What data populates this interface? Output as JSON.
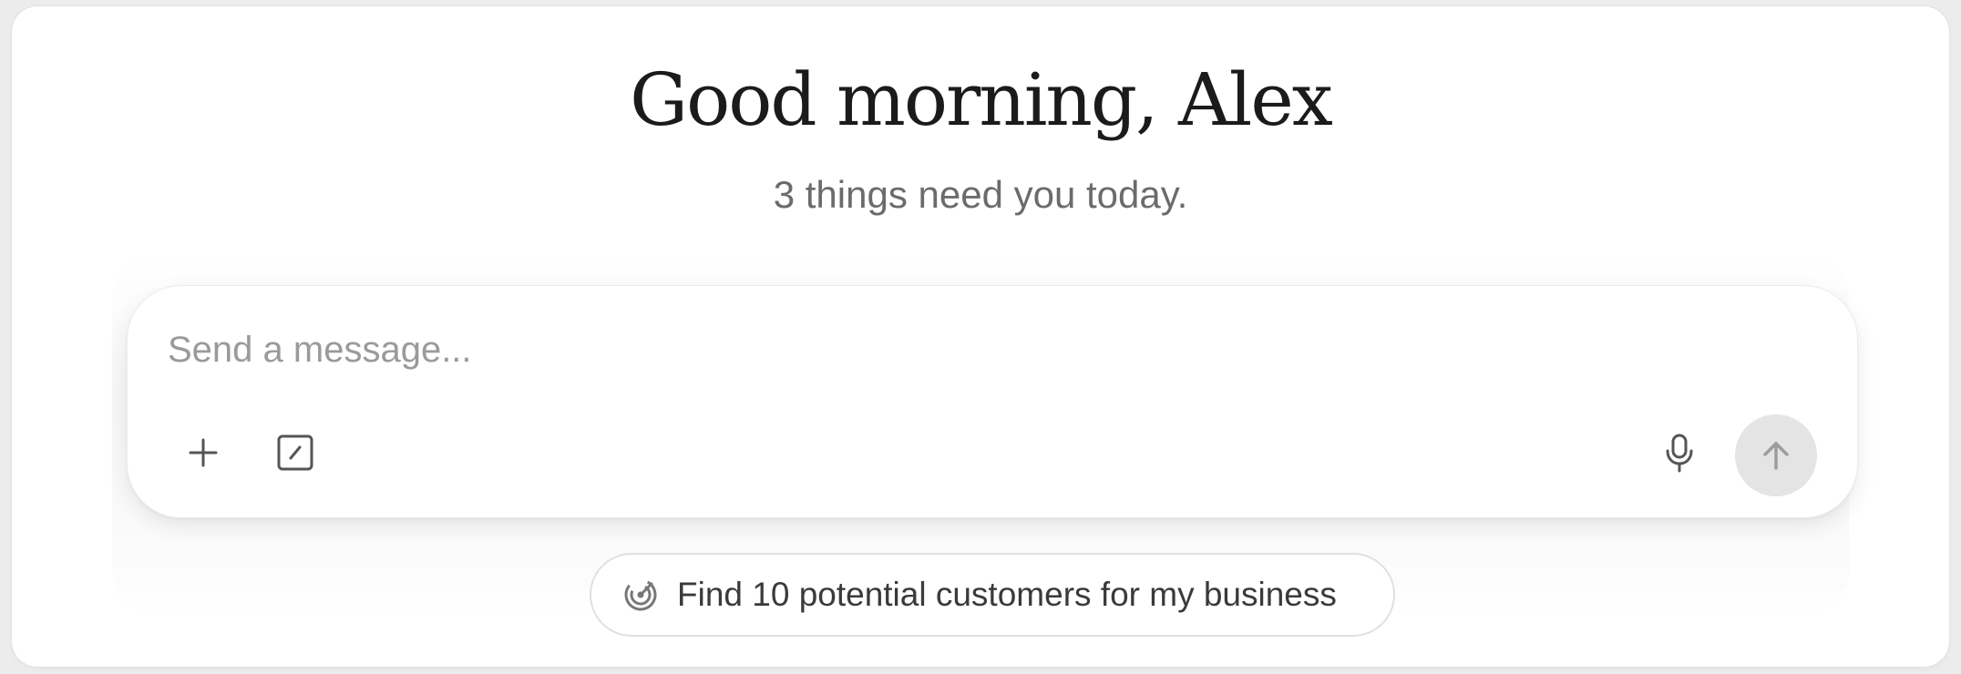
{
  "header": {
    "greeting": "Good morning, Alex",
    "subtitle": "3 things need you today."
  },
  "composer": {
    "placeholder": "Send a message...",
    "value": "",
    "tools": [
      {
        "icon": "plus-icon"
      },
      {
        "icon": "slash-square-icon"
      }
    ],
    "mic_icon": "microphone-icon",
    "send_icon": "arrow-up-icon"
  },
  "suggestion": {
    "icon": "radar-target-icon",
    "label": "Find 10 potential customers for my business"
  },
  "colors": {
    "background": "#ececec",
    "card": "#ffffff",
    "greeting_text": "#1b1b1b",
    "subtitle_text": "#6b6b6b",
    "send_button": "#e4e4e4"
  }
}
